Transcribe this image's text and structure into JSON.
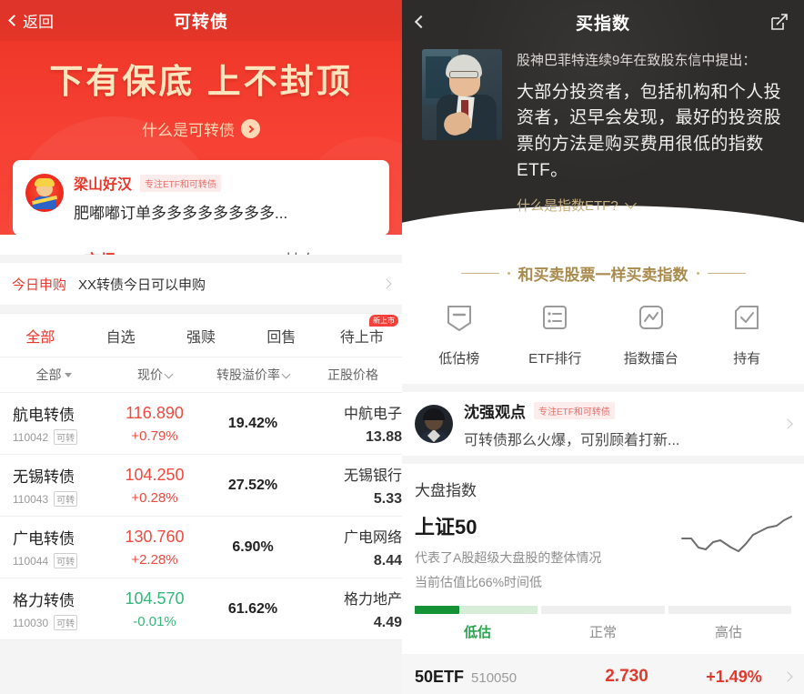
{
  "colors": {
    "brand_red": "#e8372b",
    "hero_red": "#f0382a",
    "slogan_gold": "#ffe6bf",
    "up_red": "#ef4a3f",
    "down_green": "#35b67a",
    "dark_bg": "#2e2c2a",
    "gold": "#a98b4e",
    "low_green": "#159236"
  },
  "left": {
    "nav": {
      "back_label": "返回",
      "back_icon": "chevron-left-icon",
      "title": "可转债"
    },
    "hero": {
      "slogan": "下有保底 上不封顶",
      "sub_link": "什么是可转债",
      "sub_link_icon": "circle-arrow-right-icon"
    },
    "promo": {
      "avatar_icon": "user-avatar",
      "name": "梁山好汉",
      "tag": "专注ETF和可转债",
      "desc": "肥嘟嘟订单多多多多多多多多..."
    },
    "tabs": [
      {
        "label": "市场",
        "active": true
      },
      {
        "label": "持有",
        "active": false
      }
    ],
    "notice": {
      "key": "今日申购",
      "value": "XX转债今日可以申购",
      "arrow_icon": "chevron-right-icon"
    },
    "filters": [
      {
        "label": "全部",
        "active": true,
        "badge": ""
      },
      {
        "label": "自选",
        "active": false,
        "badge": ""
      },
      {
        "label": "强赎",
        "active": false,
        "badge": ""
      },
      {
        "label": "回售",
        "active": false,
        "badge": ""
      },
      {
        "label": "待上市",
        "active": false,
        "badge": "新上市"
      }
    ],
    "columns": [
      {
        "label": "全部",
        "icon": "caret-down-icon"
      },
      {
        "label": "现价",
        "icon": "sort-icon"
      },
      {
        "label": "转股溢价率",
        "icon": "sort-icon"
      },
      {
        "label": "正股价格",
        "icon": ""
      }
    ],
    "rows": [
      {
        "name": "航电转债",
        "code": "110042",
        "badge": "可转",
        "price": "116.890",
        "change": "+0.79%",
        "dir": "up",
        "premium": "19.42%",
        "stock_name": "中航电子",
        "stock_price": "13.88"
      },
      {
        "name": "无锡转债",
        "code": "110043",
        "badge": "可转",
        "price": "104.250",
        "change": "+0.28%",
        "dir": "up",
        "premium": "27.52%",
        "stock_name": "无锡银行",
        "stock_price": "5.33"
      },
      {
        "name": "广电转债",
        "code": "110044",
        "badge": "可转",
        "price": "130.760",
        "change": "+2.28%",
        "dir": "up",
        "premium": "6.90%",
        "stock_name": "广电网络",
        "stock_price": "8.44"
      },
      {
        "name": "格力转债",
        "code": "110030",
        "badge": "可转",
        "price": "104.570",
        "change": "-0.01%",
        "dir": "down",
        "premium": "61.62%",
        "stock_name": "格力地产",
        "stock_price": "4.49"
      }
    ]
  },
  "right": {
    "nav": {
      "back_icon": "chevron-left-icon",
      "title": "买指数",
      "share_icon": "share-external-icon"
    },
    "quote": {
      "portrait_icon": "warren-buffett-portrait",
      "lead": "股神巴菲特连续9年在致股东信中提出：",
      "body": "大部分投资者，包括机构和个人投资者，迟早会发现，最好的投资股票的方法是购买费用很低的指数ETF。",
      "more_label": "什么是指数ETF?",
      "more_icon": "chevron-down-icon"
    },
    "section_title": "和买卖股票一样买卖指数",
    "icon_grid": [
      {
        "label": "低估榜",
        "icon": "shield-minus-icon"
      },
      {
        "label": "ETF排行",
        "icon": "list-rank-icon"
      },
      {
        "label": "指数擂台",
        "icon": "chart-line-icon"
      },
      {
        "label": "持有",
        "icon": "check-square-icon"
      }
    ],
    "author": {
      "avatar_icon": "user-avatar",
      "name": "沈强观点",
      "tag": "专注ETF和可转债",
      "desc": "可转债那么火爆，可别顾着打新...",
      "arrow_icon": "chevron-right-icon"
    },
    "index": {
      "category": "大盘指数",
      "name": "上证50",
      "desc1": "代表了A股超级大盘股的整体情况",
      "desc2": "当前估值比66%时间低",
      "sparkline_icon": "sparkline-chart"
    },
    "valuation": {
      "fill_percent": 12,
      "labels": [
        {
          "label": "低估",
          "active": true
        },
        {
          "label": "正常",
          "active": false
        },
        {
          "label": "高估",
          "active": false
        }
      ]
    },
    "etf": {
      "name": "50ETF",
      "code": "510050",
      "price": "2.730",
      "change": "+1.49%",
      "arrow_icon": "chevron-right-icon"
    }
  },
  "chart_data": {
    "type": "line",
    "title": "上证50 sparkline",
    "x": [
      0,
      1,
      2,
      3,
      4,
      5,
      6,
      7,
      8,
      9,
      10,
      11,
      12,
      13,
      14,
      15,
      16
    ],
    "values": [
      52,
      52,
      56,
      63,
      64,
      58,
      50,
      52,
      55,
      60,
      62,
      52,
      43,
      38,
      30,
      26,
      18
    ],
    "xlabel": "",
    "ylabel": "",
    "grid": false,
    "legend": false
  }
}
